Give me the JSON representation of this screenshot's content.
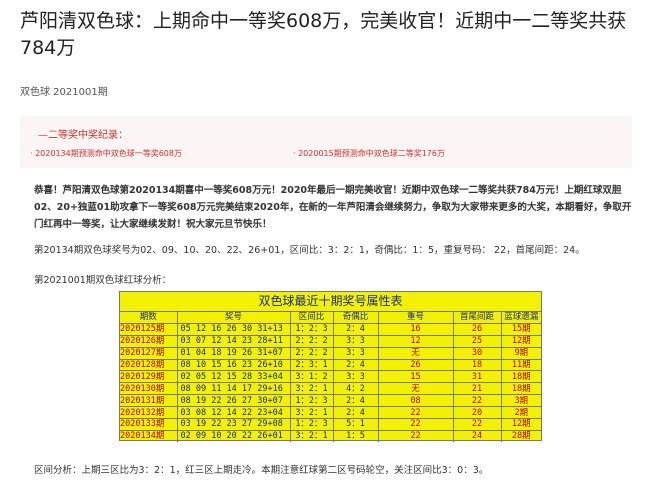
{
  "title": "芦阳清双色球：上期命中一等奖608万，完美收官！近期中一二等奖共获784万",
  "subtitle": "双色球 2021001期",
  "record": {
    "title": "—二等奖中奖纪录：",
    "items": [
      "· 2020134期预测命中双色球一等奖608万",
      "· 2020015期预测命中双色球二等奖176万"
    ]
  },
  "congrats": "恭喜！芦阳清双色球第2020134期喜中一等奖608万元！2020年最后一期完美收官！近期中双色球一二等奖共获784万元！上期红球双胆02、20+独蓝01助攻拿下一等奖608万元完美结束2020年，在新的一年芦阳清会继续努力，争取为大家带来更多的大奖，本期看好，争取开门红再中一等奖，让大家继续发财！祝大家元旦节快乐！",
  "prev_draw": "第20134期双色球奖号为02、09、10、20、22、26+01，区间比：3：2：1，奇偶比：1：5，重复号码：  22，首尾间距：24。",
  "analysis_heading": "第2021001期双色球红球分析：",
  "table": {
    "title": "双色球最近十期奖号属性表",
    "headers": [
      "期数",
      "奖号",
      "区间比",
      "奇偶比",
      "重号",
      "首尾间距",
      "蓝球遗漏"
    ],
    "rows": [
      [
        "2020125期",
        "05 12 16 26 30 31+13",
        "1：2：3",
        "2：4",
        "16",
        "26",
        "15期"
      ],
      [
        "2020126期",
        "03 07 12 14 23 28+11",
        "2：2：2",
        "3：3",
        "12",
        "25",
        "12期"
      ],
      [
        "2020127期",
        "01 04 18 19 26 31+07",
        "2：2：2",
        "3：3",
        "无",
        "30",
        "9期"
      ],
      [
        "2020128期",
        "08 10 15 16 23 26+10",
        "2：3：1",
        "2：4",
        "26",
        "18",
        "11期"
      ],
      [
        "2020129期",
        "02 05 12 15 28 33+04",
        "3：1：2",
        "3：3",
        "15",
        "31",
        "18期"
      ],
      [
        "2020130期",
        "08 09 11 14 17 29+16",
        "3：2：1",
        "4：2",
        "无",
        "21",
        "18期"
      ],
      [
        "2020131期",
        "08 19 22 26 27 30+07",
        "1：2：3",
        "2：4",
        "08",
        "22",
        "3期"
      ],
      [
        "2020132期",
        "03 08 12 14 22 23+04",
        "3：2：1",
        "2：4",
        "22",
        "20",
        "2期"
      ],
      [
        "2020133期",
        "03 19 22 23 27 29+08",
        "1：2：3",
        "5：1",
        "22",
        "22",
        "12期"
      ],
      [
        "2020134期",
        "02 09 10 20 22 26+01",
        "3：2：1",
        "1：5",
        "22",
        "24",
        "28期"
      ]
    ]
  },
  "zone_analysis": "区间分析：上期三区比为3：2：1，红三区上期走冷。本期注意红球第二区号码轮空，关注区间比3：0：3。",
  "colors": {
    "record_red": "#d93025",
    "table_bg": "#f2f200",
    "table_blue": "#1a2b8e",
    "table_red": "#c00000"
  }
}
